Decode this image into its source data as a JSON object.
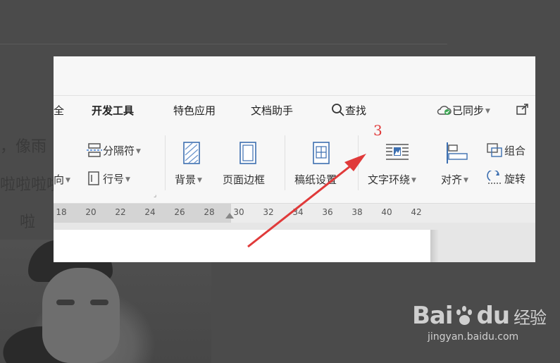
{
  "background": {
    "lines": [
      "，像雨",
      "啦啦啦啦",
      "啦"
    ]
  },
  "menu": {
    "partial_prev": "全",
    "dev_tools": "开发工具",
    "special_apps": "特色应用",
    "doc_assistant": "文档助手",
    "search": "查找",
    "synced": "已同步"
  },
  "ribbon": {
    "direction_partial": "向",
    "section_break": "分隔符",
    "line_number": "行号",
    "background": "背景",
    "page_border": "页面边框",
    "draft_paper": "稿纸设置",
    "text_wrap": "文字环绕",
    "align": "对齐",
    "group": "组合",
    "rotate": "旋转"
  },
  "ruler": {
    "ticks": [
      "18",
      "20",
      "22",
      "24",
      "26",
      "28",
      "30",
      "32",
      "34",
      "36",
      "38",
      "40",
      "42"
    ]
  },
  "annotation": {
    "step": "3",
    "color": "#e03a3a"
  },
  "watermark": {
    "brand": "Bai",
    "brand_tail": "du",
    "product": "经验",
    "url": "jingyan.baidu.com"
  }
}
